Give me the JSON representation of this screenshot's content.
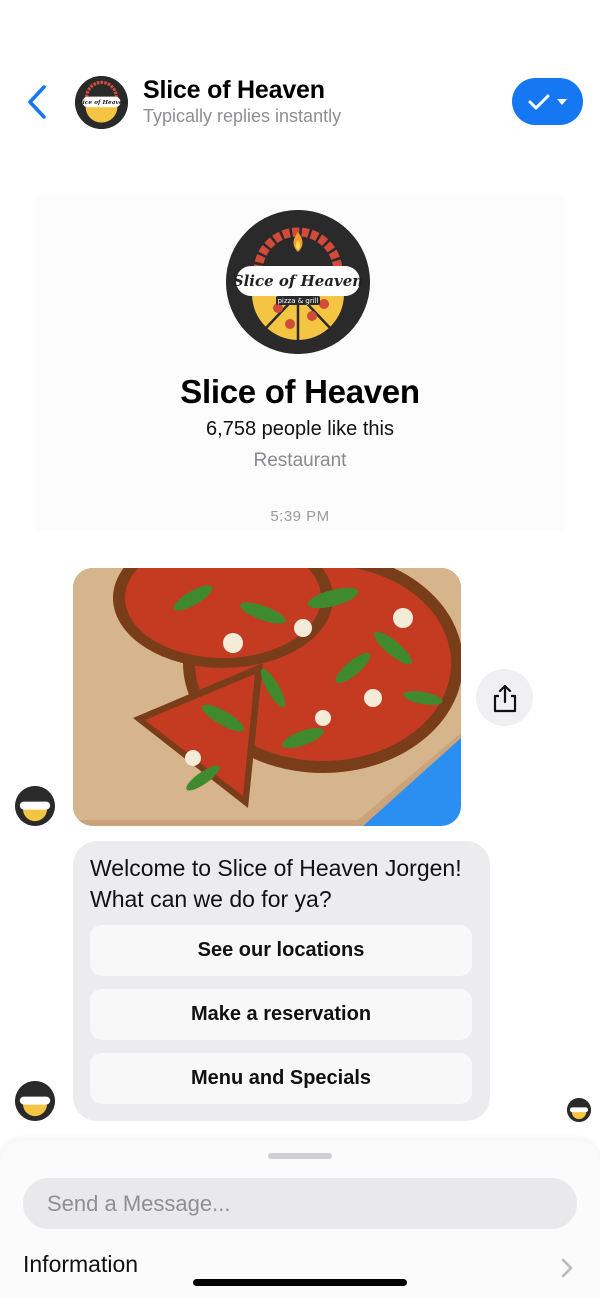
{
  "header": {
    "title": "Slice of Heaven",
    "subtitle": "Typically replies instantly",
    "back_icon": "chevron-left-icon",
    "done_icon": "checkmark-icon",
    "accent_color": "#1677f2"
  },
  "profile": {
    "name": "Slice of Heaven",
    "likes": "6,758 people like this",
    "category": "Restaurant",
    "logo": {
      "brand": "Slice of Heaven",
      "tagline": "pizza & grill"
    }
  },
  "conversation": {
    "timestamp": "5:39 PM",
    "image_alt": "pizza-photo",
    "message": "Welcome to Slice of Heaven Jorgen! What can we do for ya?",
    "quick_replies": [
      {
        "label": "See our locations"
      },
      {
        "label": "Make a reservation"
      },
      {
        "label": "Menu and Specials"
      }
    ]
  },
  "composer": {
    "placeholder": "Send a Message...",
    "info_label": "Information"
  }
}
